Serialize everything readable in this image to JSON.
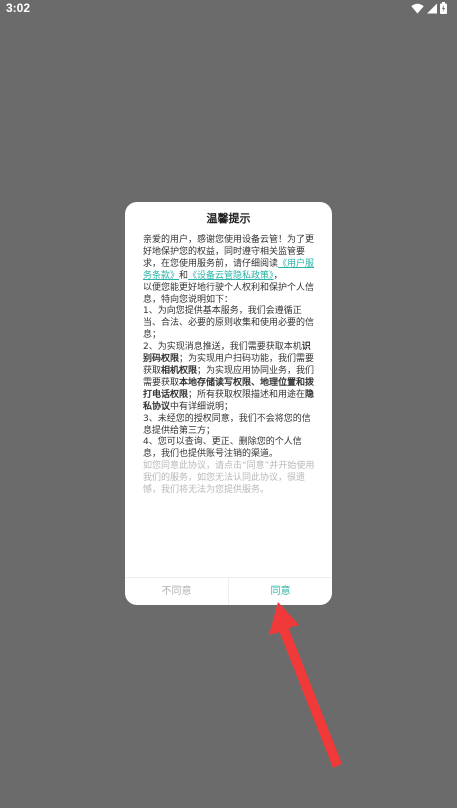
{
  "status_bar": {
    "time": "3:02"
  },
  "dialog": {
    "title": "温馨提示",
    "intro": "亲爱的用户，感谢您使用设备云管！为了更好地保护您的权益，同时遵守相关监管要求，在您使用服务前，请仔细阅读",
    "link_terms": "《用户服务条款》",
    "and": "和",
    "link_privacy": "《设备云管隐私政策》",
    "comma": "，",
    "para_1": "以便您能更好地行驶个人权利和保护个人信息，特向您说明如下：",
    "item_1": "1、为向您提供基本服务，我们会遵循正当、合法、必要的原则收集和使用必要的信息；",
    "item_2_a": "2、为实现消息推送，我们需要获取本机",
    "item_2_b": "识别码权限",
    "item_2_c": "；为实现用户扫码功能，我们需要获取",
    "item_2_d": "相机权限",
    "item_2_e": "；为实现应用协同业务，我们需要获取",
    "item_2_f": "本地存储读写权限、地理位置和拨打电话权限",
    "item_2_g": "；所有获取权限描述和用途在",
    "item_2_h": "隐私协议",
    "item_2_i": "中有详细说明；",
    "item_3": "3、未经您的授权同意，我们不会将您的信息提供给第三方；",
    "item_4": "4、您可以查询、更正、删除您的个人信息，我们也提供账号注销的渠道。",
    "note": "如您同意此协议，请点击“同意”并开始使用我们的服务，如您无法认同此协议，很遗憾，我们将无法为您提供服务。",
    "disagree_label": "不同意",
    "agree_label": "同意"
  },
  "colors": {
    "backdrop": "#6b6b6b",
    "accent": "#2ab3a6",
    "arrow": "#f03a3a"
  }
}
